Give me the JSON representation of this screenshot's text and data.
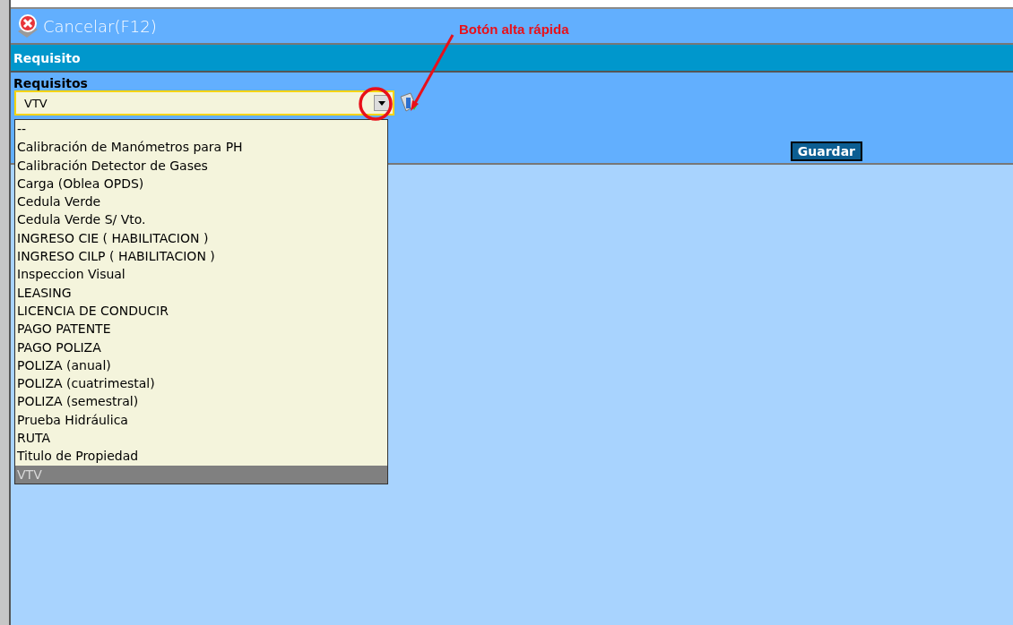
{
  "toolbar": {
    "cancel_label": "Cancelar(F12)"
  },
  "section": {
    "title": "Requisito"
  },
  "field": {
    "label": "Requisitos",
    "value": "VTV",
    "expanded": true
  },
  "options": [
    {
      "label": "--",
      "selected": false
    },
    {
      "label": "Calibración de Manómetros para PH",
      "selected": false
    },
    {
      "label": "Calibración Detector de Gases",
      "selected": false
    },
    {
      "label": "Carga (Oblea OPDS)",
      "selected": false
    },
    {
      "label": "Cedula Verde",
      "selected": false
    },
    {
      "label": "Cedula Verde S/ Vto.",
      "selected": false
    },
    {
      "label": "INGRESO CIE ( HABILITACION )",
      "selected": false
    },
    {
      "label": "INGRESO CILP ( HABILITACION )",
      "selected": false
    },
    {
      "label": "Inspeccion Visual",
      "selected": false
    },
    {
      "label": "LEASING",
      "selected": false
    },
    {
      "label": "LICENCIA DE CONDUCIR",
      "selected": false
    },
    {
      "label": "PAGO PATENTE",
      "selected": false
    },
    {
      "label": "PAGO POLIZA",
      "selected": false
    },
    {
      "label": "POLIZA (anual)",
      "selected": false
    },
    {
      "label": "POLIZA (cuatrimestal)",
      "selected": false
    },
    {
      "label": "POLIZA (semestral)",
      "selected": false
    },
    {
      "label": "Prueba Hidráulica",
      "selected": false
    },
    {
      "label": "RUTA",
      "selected": false
    },
    {
      "label": "Titulo de Propiedad",
      "selected": false
    },
    {
      "label": "VTV",
      "selected": true
    }
  ],
  "save_button": "Guardar",
  "annotation": {
    "text": "Botón alta rápida"
  }
}
